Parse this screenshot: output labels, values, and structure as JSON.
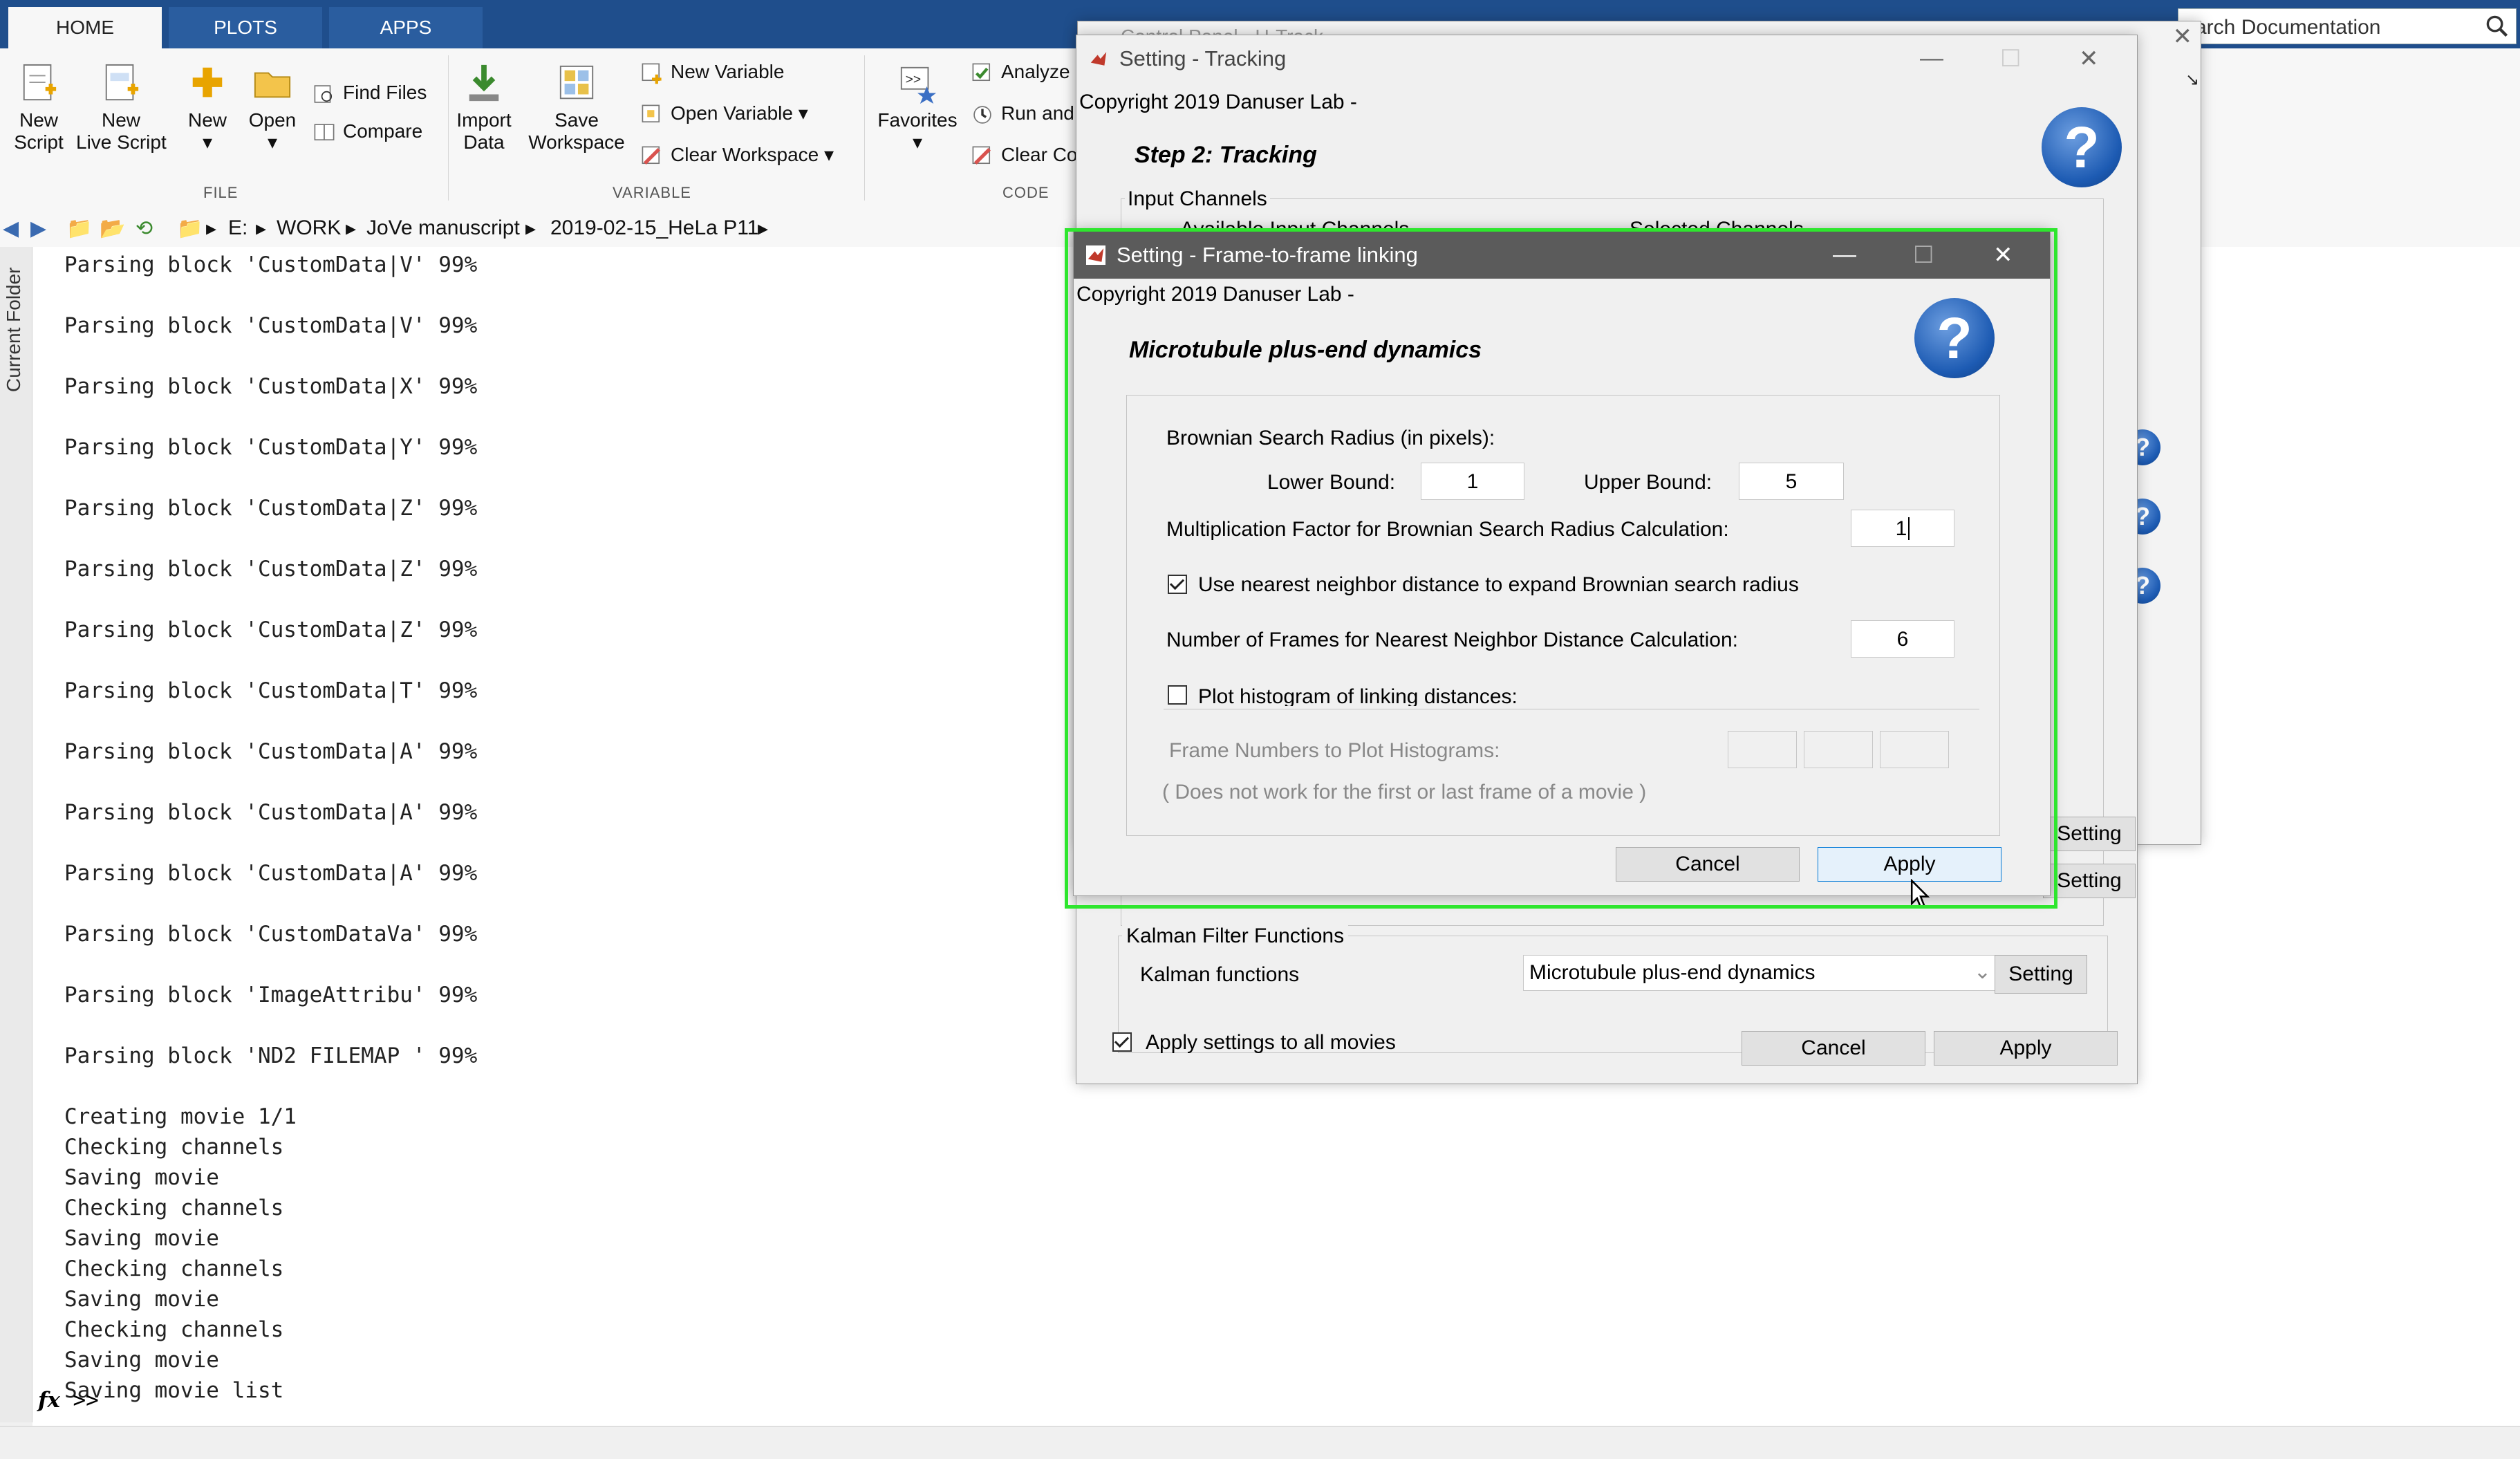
{
  "ribbon": {
    "tabs": [
      "HOME",
      "PLOTS",
      "APPS"
    ],
    "search_placeholder": "arch Documentation",
    "buttons": {
      "new_script": "New\nScript",
      "new_live_script": "New\nLive Script",
      "new": "New",
      "open": "Open",
      "find_files": "Find Files",
      "compare": "Compare",
      "import_data": "Import\nData",
      "save_workspace": "Save\nWorkspace",
      "new_variable": "New Variable",
      "open_variable": "Open Variable ▾",
      "clear_workspace": "Clear Workspace  ▾",
      "favorites": "Favorites",
      "analyze": "Analyze",
      "run_and": "Run and",
      "clear_co": "Clear Co"
    },
    "groups": [
      "FILE",
      "VARIABLE",
      "CODE"
    ]
  },
  "address": {
    "crumbs": [
      "E:",
      "WORK",
      "JoVe manuscript",
      "2019-02-15_HeLa P11"
    ]
  },
  "left_panel_label": "Current Folder",
  "console": {
    "lines": [
      "Parsing block 'CustomData|V' 99%",
      "",
      "Parsing block 'CustomData|V' 99%",
      "",
      "Parsing block 'CustomData|X' 99%",
      "",
      "Parsing block 'CustomData|Y' 99%",
      "",
      "Parsing block 'CustomData|Z' 99%",
      "",
      "Parsing block 'CustomData|Z' 99%",
      "",
      "Parsing block 'CustomData|Z' 99%",
      "",
      "Parsing block 'CustomData|T' 99%",
      "",
      "Parsing block 'CustomData|A' 99%",
      "",
      "Parsing block 'CustomData|A' 99%",
      "",
      "Parsing block 'CustomData|A' 99%",
      "",
      "Parsing block 'CustomDataVa' 99%",
      "",
      "Parsing block 'ImageAttribu' 99%",
      "",
      "Parsing block 'ND2 FILEMAP ' 99%",
      "",
      "Creating movie 1/1",
      "Checking channels",
      "Saving movie",
      "Checking channels",
      "Saving movie",
      "Checking channels",
      "Saving movie",
      "Checking channels",
      "Saving movie",
      "Saving movie list"
    ],
    "prompt": ">>"
  },
  "back_window_title": "Control Panel - U-Track",
  "tracking_dialog": {
    "title": "Setting - Tracking",
    "copyright": "Copyright 2019 Danuser Lab -",
    "step_title": "Step 2: Tracking",
    "input_channels": "Input Channels",
    "available_channels": "Available Input Channels",
    "selected_channels": "Selected Channels",
    "setting_label": "Setting",
    "kalman_group": "Kalman Filter Functions",
    "kalman_label": "Kalman functions",
    "kalman_value": "Microtubule plus-end dynamics",
    "kalman_setting": "Setting",
    "apply_all": "Apply settings to all movies",
    "cancel": "Cancel",
    "apply": "Apply"
  },
  "linking_dialog": {
    "title": "Setting - Frame-to-frame linking",
    "copyright": "Copyright 2019 Danuser Lab -",
    "heading": "Microtubule plus-end dynamics",
    "brownian_label": "Brownian Search Radius (in pixels):",
    "lower_label": "Lower Bound:",
    "lower_value": "1",
    "upper_label": "Upper Bound:",
    "upper_value": "5",
    "mult_label": "Multiplication Factor for Brownian Search Radius Calculation:",
    "mult_value": "1",
    "use_nn_label": "Use nearest neighbor distance to expand Brownian search radius",
    "use_nn_checked": true,
    "frames_label": "Number of Frames for Nearest Neighbor Distance Calculation:",
    "frames_value": "6",
    "plot_hist_label": "Plot histogram of linking distances:",
    "plot_hist_checked": false,
    "frame_numbers_label": "Frame Numbers to Plot Histograms:",
    "frame_numbers_note": "( Does not work for the first or last frame of a movie )",
    "cancel": "Cancel",
    "apply": "Apply"
  },
  "colors": {
    "ribbon_tab_bg": "#1f4e8c",
    "highlight": "#2ee62e",
    "help_blue": "#1d5bb3"
  }
}
